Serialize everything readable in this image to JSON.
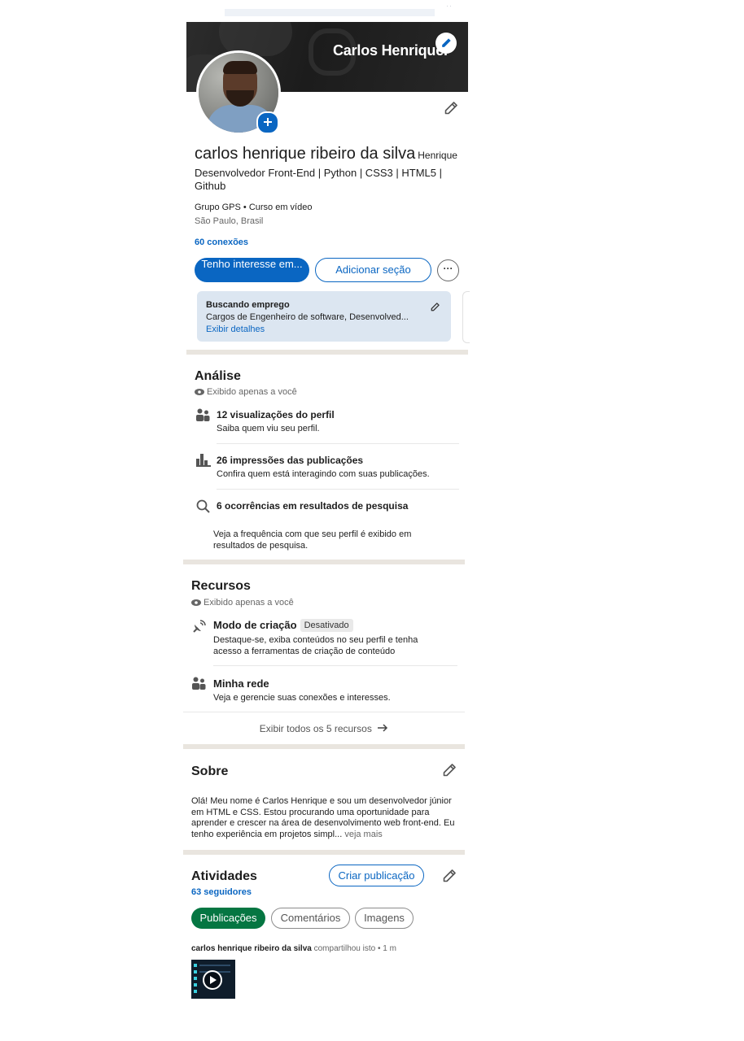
{
  "banner": {
    "name": "Carlos Henrique."
  },
  "profile": {
    "name": "carlos henrique ribeiro da silva",
    "pronoun": "Henrique",
    "headline": "Desenvolvedor Front-End | Python | CSS3 | HTML5 | Github",
    "company": "Grupo GPS • Curso em vídeo",
    "location": "São Paulo, Brasil",
    "connections": "60 conexões"
  },
  "actions": {
    "primary": "Tenho interesse em...",
    "secondary": "Adicionar seção",
    "more": "···"
  },
  "open_to_work": {
    "title": "Buscando emprego",
    "roles": "Cargos de Engenheiro de software, Desenvolved...",
    "link": "Exibir detalhes"
  },
  "analytics": {
    "title": "Análise",
    "private_note": "Exibido apenas a você",
    "items": [
      {
        "title": "12 visualizações do perfil",
        "subtitle": "Saiba quem viu seu perfil."
      },
      {
        "title": "26 impressões das publicações",
        "subtitle": "Confira quem está interagindo com suas publicações."
      },
      {
        "title": "6 ocorrências em resultados de pesquisa",
        "subtitle": "Veja a frequência com que seu perfil é exibido em resultados de pesquisa."
      }
    ]
  },
  "resources": {
    "title": "Recursos",
    "private_note": "Exibido apenas a você",
    "items": [
      {
        "title": "Modo de criação",
        "badge": "Desativado",
        "subtitle": "Destaque-se, exiba conteúdos no seu perfil e tenha acesso a ferramentas de criação de conteúdo"
      },
      {
        "title": "Minha rede",
        "subtitle": "Veja e gerencie suas conexões e interesses."
      }
    ],
    "show_all": "Exibir todos os 5 recursos"
  },
  "about": {
    "title": "Sobre",
    "text": "Olá! Meu nome é Carlos Henrique e sou um desenvolvedor júnior em HTML e CSS. Estou procurando uma oportunidade para aprender e crescer na área de desenvolvimento web front-end. Eu tenho experiência em projetos simpl...",
    "more": " veja mais"
  },
  "activity": {
    "title": "Atividades",
    "followers": "63 seguidores",
    "create_post": "Criar publicação",
    "tabs": [
      "Publicações",
      "Comentários",
      "Imagens"
    ],
    "post": {
      "author": "carlos henrique ribeiro da silva",
      "meta": " compartilhou isto • 1 m"
    }
  },
  "colors": {
    "brand_blue": "#0a66c2",
    "active_green": "#057642",
    "divider": "#e9e5df",
    "open_to_work_bg": "#dce6f1"
  }
}
